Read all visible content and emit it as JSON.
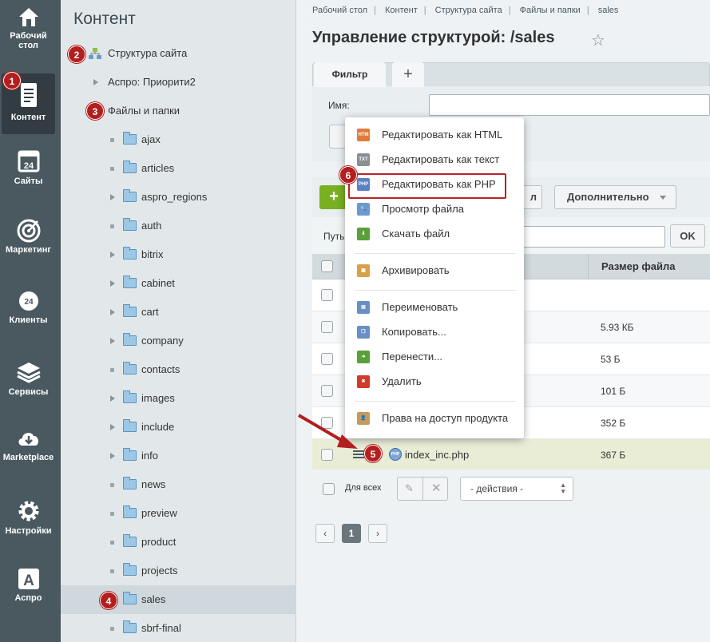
{
  "nav": [
    {
      "key": "desktop",
      "label_lines": [
        "Рабочий",
        "стол"
      ]
    },
    {
      "key": "content",
      "label_lines": [
        "Контент"
      ]
    },
    {
      "key": "sites",
      "label_lines": [
        "Сайты"
      ]
    },
    {
      "key": "marketing",
      "label_lines": [
        "Маркетинг"
      ]
    },
    {
      "key": "clients",
      "label_lines": [
        "Клиенты"
      ]
    },
    {
      "key": "services",
      "label_lines": [
        "Сервисы"
      ]
    },
    {
      "key": "marketplace",
      "label_lines": [
        "Marketplace"
      ]
    },
    {
      "key": "settings",
      "label_lines": [
        "Настройки"
      ]
    },
    {
      "key": "aspro",
      "label_lines": [
        "Аспро"
      ]
    }
  ],
  "nav_icon_24": "24",
  "nav_icon_a": "A",
  "tree": {
    "title": "Контент",
    "structure_label": "Структура сайта",
    "aspro_priority": "Аспро: Приорити2",
    "files_label": "Файлы и папки",
    "folders": [
      "ajax",
      "articles",
      "aspro_regions",
      "auth",
      "bitrix",
      "cabinet",
      "cart",
      "company",
      "contacts",
      "images",
      "include",
      "info",
      "news",
      "preview",
      "product",
      "projects",
      "sales",
      "sbrf-final"
    ]
  },
  "breadcrumb": [
    "Рабочий стол",
    "Контент",
    "Структура сайта",
    "Файлы и папки",
    "sales"
  ],
  "page_title": "Управление структурой: /sales",
  "star": "☆",
  "filter": {
    "tab_label": "Фильтр",
    "add_tab": "+",
    "name_label": "Имя:"
  },
  "toolbar": {
    "add": "+",
    "partial_btn": "л",
    "more": "Дополнительно"
  },
  "path_label": "Путь",
  "ok": "OK",
  "table": {
    "size_header": "Размер файла",
    "rows": [
      {
        "size": ""
      },
      {
        "size": "5.93 КБ"
      },
      {
        "size": "53 Б"
      },
      {
        "size": "101 Б"
      },
      {
        "size": "352 Б"
      },
      {
        "size": "367 Б",
        "name": "index_inc.php"
      }
    ]
  },
  "php_badge": "PHP",
  "footer": {
    "all_label": "Для всех",
    "pencil": "✎",
    "close": "✕",
    "actions": "- действия -",
    "arrows": "▲▼"
  },
  "pagination": {
    "prev": "‹",
    "current": "1",
    "next": "›"
  },
  "context_menu": [
    {
      "label": "Редактировать как HTML",
      "icon": "html-icon",
      "color": "#e07a3a",
      "glyph": "HTM"
    },
    {
      "label": "Редактировать как текст",
      "icon": "txt-icon",
      "color": "#8a8f94",
      "glyph": "TXT"
    },
    {
      "label": "Редактировать как PHP",
      "icon": "php-file-icon",
      "color": "#5a82c2",
      "glyph": "PHP"
    },
    {
      "label": "Просмотр файла",
      "icon": "magnifier-icon",
      "color": "#6a9ad0",
      "glyph": "🔍"
    },
    {
      "label": "Скачать файл",
      "icon": "download-icon",
      "color": "#5aa03a",
      "glyph": "⬇"
    },
    {
      "label": "Архивировать",
      "icon": "archive-icon",
      "color": "#d9a048",
      "glyph": "▣"
    },
    {
      "label": "Переименовать",
      "icon": "rename-icon",
      "color": "#6a8fc4",
      "glyph": "▤"
    },
    {
      "label": "Копировать...",
      "icon": "copy-icon",
      "color": "#6a8fc4",
      "glyph": "❐"
    },
    {
      "label": "Перенести...",
      "icon": "move-icon",
      "color": "#5aa03a",
      "glyph": "➔"
    },
    {
      "label": "Удалить",
      "icon": "delete-icon",
      "color": "#d23a2a",
      "glyph": "✖"
    },
    {
      "label": "Права на доступ продукта",
      "icon": "user-lock-icon",
      "color": "#c89a5a",
      "glyph": "👤"
    }
  ],
  "badges": [
    "1",
    "2",
    "3",
    "4",
    "5",
    "6"
  ],
  "colors": {
    "accent_red": "#b31e1e",
    "add_green": "#78b021",
    "nav_bg": "#4a5860"
  }
}
